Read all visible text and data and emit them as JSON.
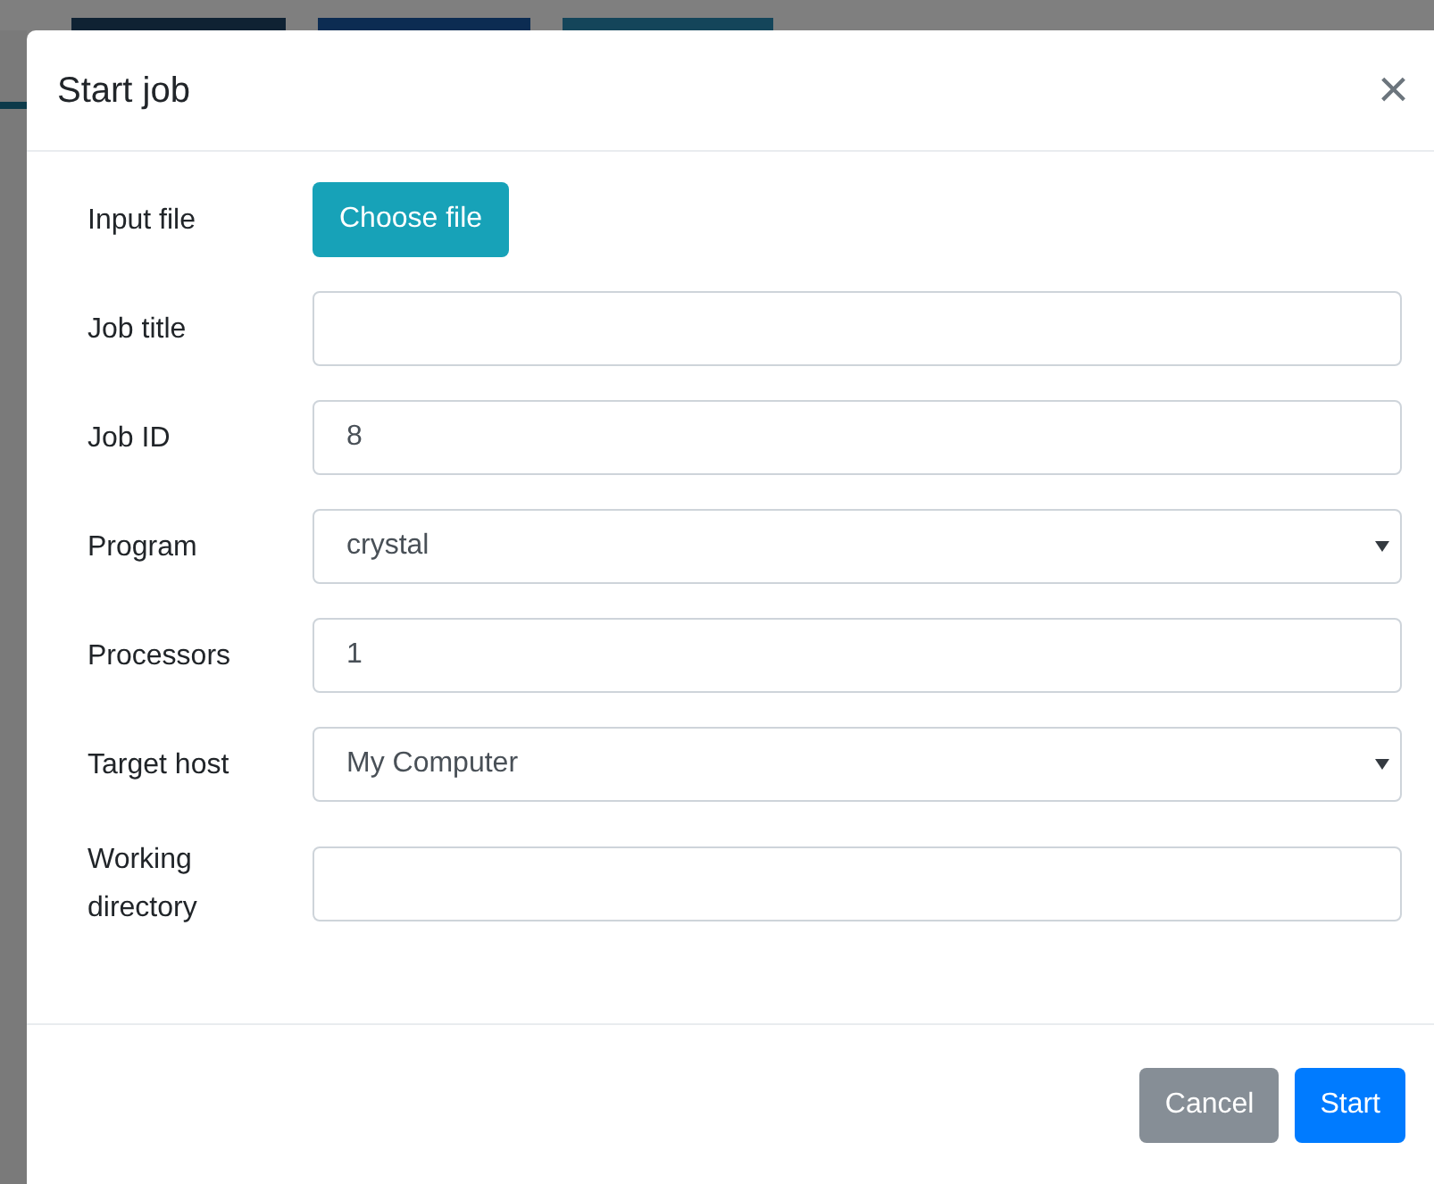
{
  "dialog": {
    "title": "Start job",
    "close": "×",
    "fields": [
      {
        "kind": "file",
        "label": "Input file",
        "button": "Choose file"
      },
      {
        "kind": "text",
        "label": "Job title"
      },
      {
        "kind": "text",
        "label": "Job ID",
        "value": "8"
      },
      {
        "kind": "select",
        "label": "Program",
        "value": "crystal"
      },
      {
        "kind": "text",
        "label": "Processors",
        "value": "1"
      },
      {
        "kind": "select",
        "label": "Target host",
        "value": "My Computer"
      },
      {
        "kind": "text",
        "label": "Working directory"
      }
    ],
    "buttons": [
      {
        "label": "Cancel",
        "kind": "secondary"
      },
      {
        "label": "Start",
        "kind": "primary"
      }
    ]
  }
}
